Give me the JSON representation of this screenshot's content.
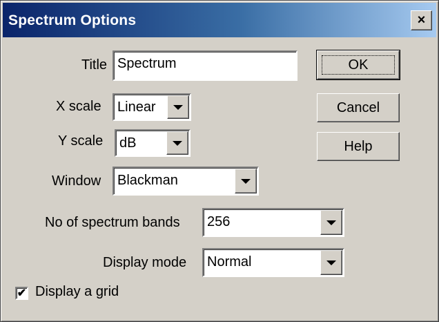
{
  "window": {
    "title": "Spectrum Options",
    "close_glyph": "×"
  },
  "form": {
    "title_label": "Title",
    "title_value": "Spectrum",
    "xscale_label": "X scale",
    "xscale_value": "Linear",
    "yscale_label": "Y scale",
    "yscale_value": "dB",
    "window_label": "Window",
    "window_value": "Blackman",
    "bands_label": "No of spectrum bands",
    "bands_value": "256",
    "display_mode_label": "Display mode",
    "display_mode_value": "Normal",
    "grid_label": "Display a grid",
    "grid_checked": true,
    "check_glyph": "✔"
  },
  "buttons": {
    "ok": "OK",
    "cancel": "Cancel",
    "help": "Help"
  },
  "icons": {
    "close": "close-icon",
    "dropdown": "chevron-down-icon",
    "check": "checkmark-icon"
  }
}
